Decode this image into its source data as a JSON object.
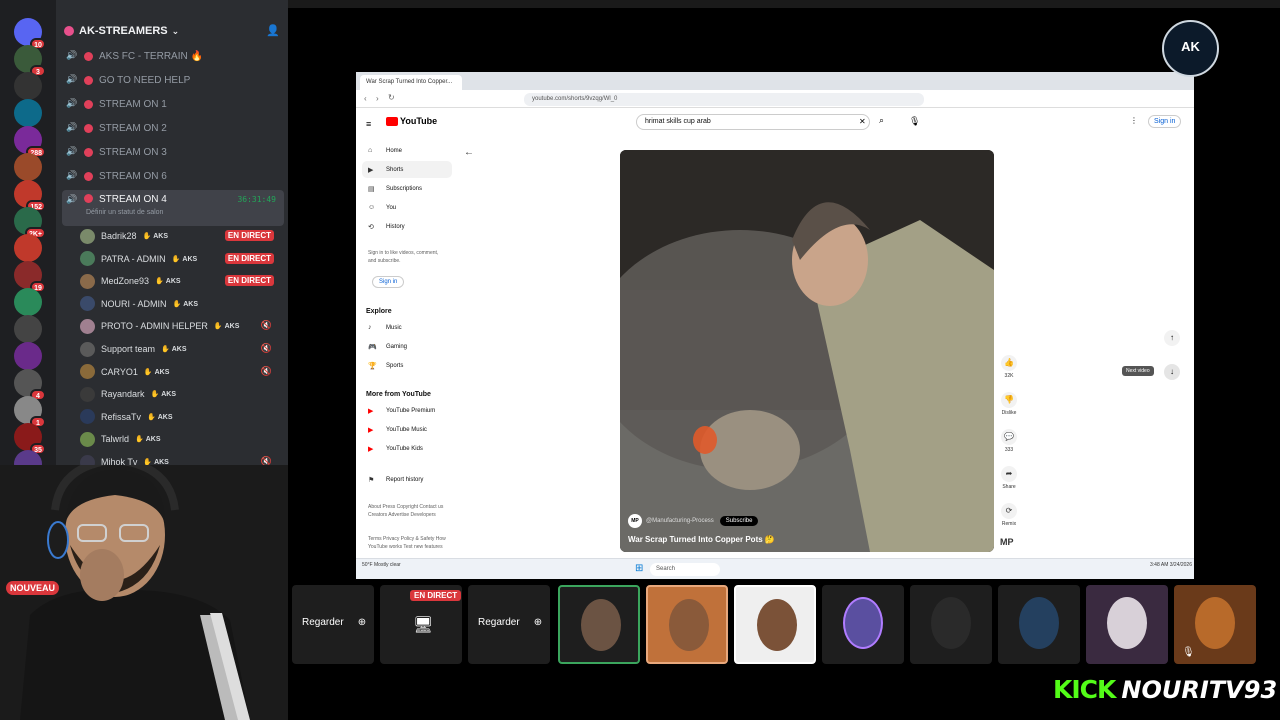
{
  "server": {
    "name": "AK-STREAMERS",
    "badges": [
      "10",
      "3",
      "",
      "",
      "288",
      "",
      "152",
      "2K+",
      "",
      "19",
      "",
      "",
      "",
      "4",
      "1",
      "35",
      "",
      "",
      ""
    ]
  },
  "channels": [
    {
      "label": "AKS FC - TERRAIN 🔥"
    },
    {
      "label": "GO TO NEED HELP"
    },
    {
      "label": "STREAM ON 1"
    },
    {
      "label": "STREAM ON 2"
    },
    {
      "label": "STREAM ON 3"
    },
    {
      "label": "STREAM ON 6"
    }
  ],
  "active_channel": {
    "label": "STREAM ON 4",
    "time": "36:31:49",
    "status_hint": "Définir un statut de salon"
  },
  "users": [
    {
      "name": "Badrik28",
      "tag": "AKS",
      "live": "EN DIRECT"
    },
    {
      "name": "PATRA - ADMIN",
      "tag": "AKS",
      "live": "EN DIRECT"
    },
    {
      "name": "MedZone93",
      "tag": "AKS",
      "live": "EN DIRECT"
    },
    {
      "name": "NOURI - ADMIN",
      "tag": "AKS",
      "live": ""
    },
    {
      "name": "PROTO - ADMIN HELPER",
      "tag": "AKS",
      "live": ""
    },
    {
      "name": "Support team",
      "tag": "AKS",
      "live": ""
    },
    {
      "name": "CARYO1",
      "tag": "AKS",
      "live": ""
    },
    {
      "name": "Rayandark",
      "tag": "AKS",
      "live": ""
    },
    {
      "name": "RefissaTv",
      "tag": "AKS",
      "live": ""
    },
    {
      "name": "Talwrld",
      "tag": "AKS",
      "live": ""
    },
    {
      "name": "Mihok Tv",
      "tag": "AKS",
      "live": ""
    }
  ],
  "nouveau": "NOUVEAU",
  "browser": {
    "tab_title": "War Scrap Turned Into Copper...",
    "url": "youtube.com/shorts/9vzqg/Wl_0",
    "logo": "YouTube",
    "search_value": "hrimat skills cup arab",
    "signin": "Sign in",
    "nav": [
      "Home",
      "Shorts",
      "Subscriptions",
      "You",
      "History"
    ],
    "signin_prompt": "Sign in to like videos, comment, and subscribe.",
    "explore_title": "Explore",
    "explore": [
      "Music",
      "Gaming",
      "Sports"
    ],
    "more_title": "More from YouTube",
    "more": [
      "YouTube Premium",
      "YouTube Music",
      "YouTube Kids"
    ],
    "report": "Report history",
    "footer1": "About Press Copyright Contact us Creators Advertise Developers",
    "footer2": "Terms Privacy Policy & Safety How YouTube works Test new features",
    "video_title": "War Scrap Turned Into Copper Pots 🤔",
    "channel_handle": "@Manufacturing-Process",
    "subscribe": "Subscribe",
    "likes": "32K",
    "dislike": "Dislike",
    "comments": "333",
    "share": "Share",
    "remix": "Remix",
    "next_video": "Next video",
    "taskbar_search": "Search",
    "weather": "50°F Mostly clear",
    "clock": "3:48 AM 3/24/2026"
  },
  "tiles": {
    "regarder1": "Regarder",
    "regarder2": "Regarder",
    "live": "EN DIRECT"
  },
  "logo_text": "AK",
  "brand": {
    "kick": "KICK",
    "name": "NOURITV93"
  }
}
